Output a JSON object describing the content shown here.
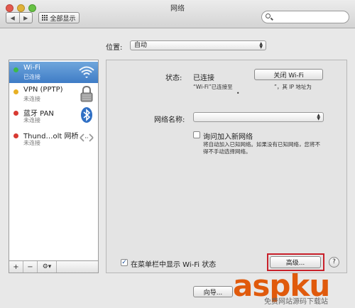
{
  "window": {
    "title": "网络",
    "show_all_label": "全部显示",
    "nav_back": "◀",
    "nav_forward": "▶",
    "search_placeholder": ""
  },
  "location": {
    "label": "位置:",
    "value": "自动"
  },
  "sidebar": {
    "items": [
      {
        "name": "Wi-Fi",
        "status": "已连接",
        "dot_color": "#3cb94a",
        "icon": "wifi-icon",
        "selected": true
      },
      {
        "name": "VPN (PPTP)",
        "status": "未连接",
        "dot_color": "#e8b024",
        "icon": "lock-icon",
        "selected": false
      },
      {
        "name": "蓝牙 PAN",
        "status": "未连接",
        "dot_color": "#d83a32",
        "icon": "bluetooth-icon",
        "selected": false
      },
      {
        "name": "Thund…olt 网桥",
        "status": "未连接",
        "dot_color": "#d83a32",
        "icon": "bridge-icon",
        "selected": false
      }
    ],
    "footer": {
      "add": "+",
      "remove": "−",
      "gear": "⚙▾"
    }
  },
  "panel": {
    "status_label": "状态:",
    "status_value": "已连接",
    "turn_off_button": "关闭 Wi-Fi",
    "status_detail_left": "“Wi-Fi”已连接至",
    "status_detail_right": "”，其 IP 地址为",
    "status_detail_bullet": "•",
    "network_name_label": "网络名称:",
    "network_name_value": "",
    "ask_join_label": "询问加入新网络",
    "ask_join_desc_1": "将自动加入已知网络。如果没有已知网络，您将不",
    "ask_join_desc_2": "得不手动选择网络。",
    "show_in_menubar_label": "在菜单栏中显示 Wi-Fi 状态",
    "advanced_button": "高级...",
    "help_button": "?",
    "assist_button": "向导..."
  },
  "watermark": {
    "logo": "aspku",
    "sub": "免费网站源码下载站"
  },
  "colors": {
    "selection": "#4a86cc",
    "highlight_border": "#c8202a",
    "watermark": "#e05a0c"
  }
}
